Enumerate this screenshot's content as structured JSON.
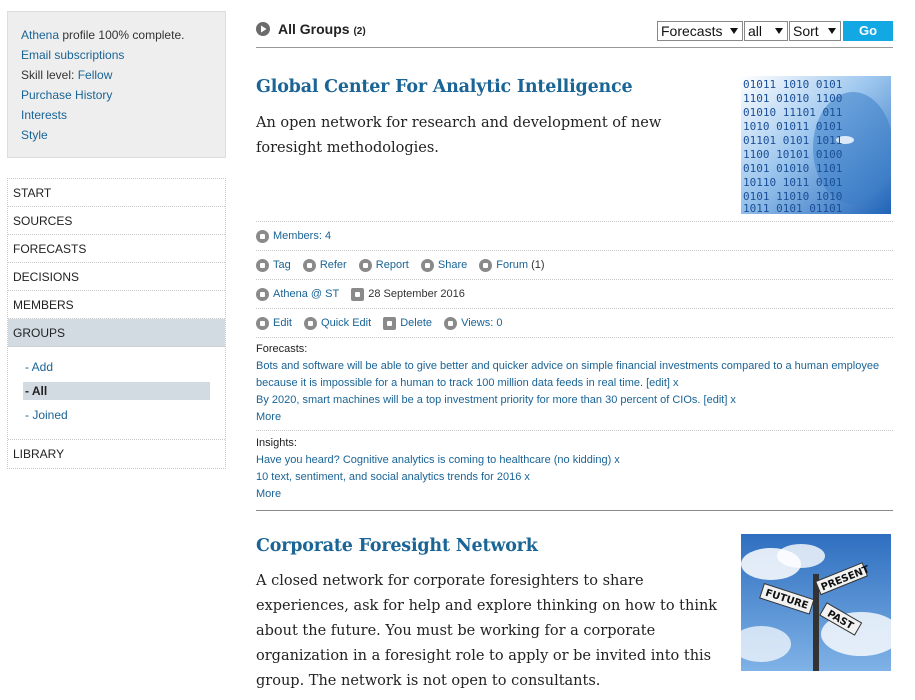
{
  "profile": {
    "complete_link": "Athena",
    "complete_text": " profile 100% complete.",
    "email_subscriptions": "Email subscriptions",
    "skill_label": "Skill level: ",
    "skill_value": "Fellow",
    "purchase_history": "Purchase History",
    "interests": "Interests",
    "style": "Style"
  },
  "nav": {
    "start": "START",
    "sources": "SOURCES",
    "forecasts": "FORECASTS",
    "decisions": "DECISIONS",
    "members": "MEMBERS",
    "groups": "GROUPS",
    "sub_add": "- Add",
    "sub_all": "- All",
    "sub_joined": "- Joined",
    "library": "LIBRARY"
  },
  "header": {
    "title": "All Groups",
    "count": "(2)",
    "filter_type": "Forecasts",
    "filter_scope": "all",
    "sort": "Sort",
    "go": "Go"
  },
  "groups": [
    {
      "title": "Global Center For Analytic Intelligence",
      "description": "An open network for research and development of new foresight methodologies.",
      "members": "Members: 4",
      "tag": "Tag",
      "refer": "Refer",
      "report": "Report",
      "share": "Share",
      "forum": "Forum",
      "forum_count": "(1)",
      "author": "Athena @ ST",
      "date": "28 September 2016",
      "edit": "Edit",
      "quick_edit": "Quick Edit",
      "delete": "Delete",
      "views": "Views: 0",
      "forecasts_label": "Forecasts:",
      "forecasts": [
        "Bots and software will be able to give better and quicker advice on simple financial investments compared to a human employee because it is impossible for a human to track 100 million data feeds in real time. [edit] x",
        "By 2020, smart machines will be a top investment priority for more than 30 percent of CIOs. [edit] x"
      ],
      "forecasts_more": "More",
      "insights_label": "Insights:",
      "insights": [
        "Have you heard? Cognitive analytics is coming to healthcare (no kidding) x",
        "10 text, sentiment, and social analytics trends for 2016 x"
      ],
      "insights_more": "More"
    },
    {
      "title": "Corporate Foresight Network",
      "description": "A closed network for corporate foresighters to share experiences, ask for help and explore thinking on how to think about the future. You must be working for a corporate organization in a foresight role to apply or be invited into this group. The network is not open to consultants.",
      "sign_future": "FUTURE",
      "sign_present": "PRESENT",
      "sign_past": "PAST"
    }
  ]
}
